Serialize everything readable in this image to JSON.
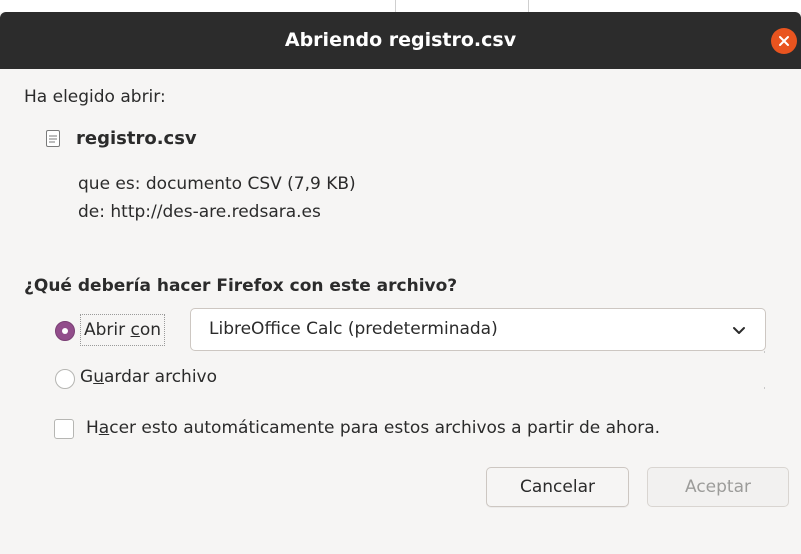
{
  "window": {
    "title": "Abriendo registro.csv"
  },
  "dialog": {
    "intro": "Ha elegido abrir:",
    "filename": "registro.csv",
    "file_type_line": "que es: documento CSV (7,9 KB)",
    "source_line": "de: http://des-are.redsara.es",
    "question": "¿Qué debería hacer Firefox con este archivo?",
    "open_with": {
      "label_pre": "Abrir ",
      "label_mnemonic": "c",
      "label_post": "on",
      "selected": true,
      "application": "LibreOffice Calc (predeterminada)"
    },
    "save_file": {
      "label_pre": "G",
      "label_mnemonic": "u",
      "label_post": "ardar archivo",
      "selected": false
    },
    "auto_checkbox": {
      "label_pre": "H",
      "label_mnemonic": "a",
      "label_post": "cer esto automáticamente para estos archivos a partir de ahora.",
      "checked": false
    }
  },
  "buttons": {
    "cancel": "Cancelar",
    "accept": "Aceptar",
    "accept_enabled": false
  },
  "icons": {
    "close": "close-icon",
    "file": "document-icon",
    "dropdown": "chevron-down-icon"
  },
  "colors": {
    "titlebar": "#2c2c2c",
    "close_button": "#e9541f",
    "radio_accent": "#924d8b",
    "dialog_bg": "#f6f5f4"
  }
}
